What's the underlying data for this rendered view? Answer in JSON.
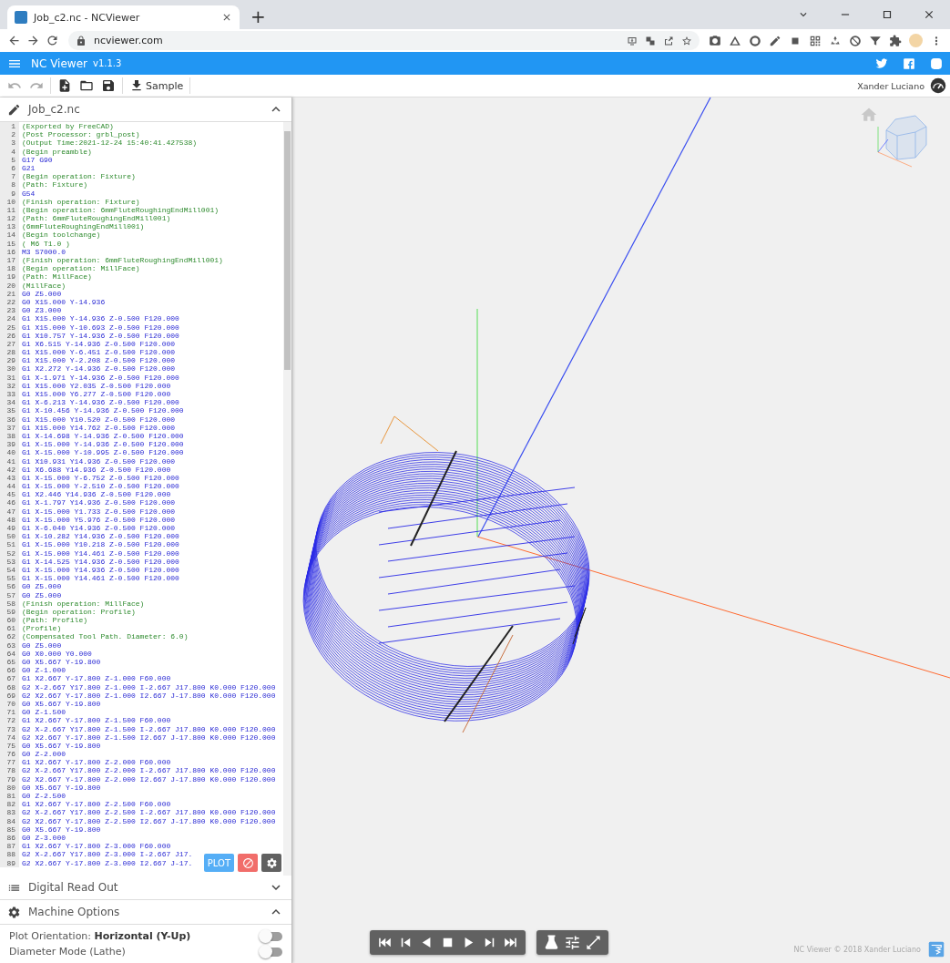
{
  "browser": {
    "tab_title": "Job_c2.nc - NCViewer",
    "new_tab": "+",
    "url": "ncviewer.com"
  },
  "app_bar": {
    "title": "NC Viewer",
    "version": "v1.1.3"
  },
  "toolbar": {
    "buttons": [
      {
        "kind": "undo",
        "disabled": true
      },
      {
        "kind": "redo",
        "disabled": true
      },
      {
        "kind": "new_file",
        "disabled": false
      },
      {
        "kind": "open",
        "disabled": false
      },
      {
        "kind": "save",
        "disabled": false
      },
      {
        "kind": "download",
        "label": "Sample",
        "disabled": false
      }
    ],
    "user": "Xander Luciano"
  },
  "editor": {
    "title": "Job_c2.nc",
    "expanded": true,
    "lines": [
      {
        "n": "1",
        "text": "(Exported by FreeCAD)",
        "kind": "comment"
      },
      {
        "n": "2",
        "text": "(Post Processor: grbl_post)",
        "kind": "comment"
      },
      {
        "n": "3",
        "text": "(Output Time:2021-12-24 15:40:41.427538)",
        "kind": "comment"
      },
      {
        "n": "4",
        "text": "(Begin preamble)",
        "kind": "comment"
      },
      {
        "n": "5",
        "text": "G17 G90",
        "kind": "code"
      },
      {
        "n": "6",
        "text": "G21",
        "kind": "code"
      },
      {
        "n": "7",
        "text": "(Begin operation: Fixture)",
        "kind": "comment"
      },
      {
        "n": "8",
        "text": "(Path: Fixture)",
        "kind": "comment"
      },
      {
        "n": "9",
        "text": "G54",
        "kind": "code"
      },
      {
        "n": "10",
        "text": "(Finish operation: Fixture)",
        "kind": "comment"
      },
      {
        "n": "11",
        "text": "(Begin operation: 6mmFluteRoughingEndMill001)",
        "kind": "comment"
      },
      {
        "n": "12",
        "text": "(Path: 6mmFluteRoughingEndMill001)",
        "kind": "comment"
      },
      {
        "n": "13",
        "text": "(6mmFluteRoughingEndMill001)",
        "kind": "comment"
      },
      {
        "n": "14",
        "text": "(Begin toolchange)",
        "kind": "comment"
      },
      {
        "n": "15",
        "text": "( M6 T1.0 )",
        "kind": "comment"
      },
      {
        "n": "16",
        "text": "M3 S7000.0",
        "kind": "code"
      },
      {
        "n": "17",
        "text": "(Finish operation: 6mmFluteRoughingEndMill001)",
        "kind": "comment"
      },
      {
        "n": "18",
        "text": "(Begin operation: MillFace)",
        "kind": "comment"
      },
      {
        "n": "19",
        "text": "(Path: MillFace)",
        "kind": "comment"
      },
      {
        "n": "20",
        "text": "(MillFace)",
        "kind": "comment"
      },
      {
        "n": "21",
        "text": "G0 Z5.000",
        "kind": "code"
      },
      {
        "n": "22",
        "text": "G0 X15.000 Y-14.936",
        "kind": "code"
      },
      {
        "n": "23",
        "text": "G0 Z3.000",
        "kind": "code"
      },
      {
        "n": "24",
        "text": "G1 X15.000 Y-14.936 Z-0.500 F120.000",
        "kind": "code"
      },
      {
        "n": "25",
        "text": "G1 X15.000 Y-10.693 Z-0.500 F120.000",
        "kind": "code"
      },
      {
        "n": "26",
        "text": "G1 X10.757 Y-14.936 Z-0.500 F120.000",
        "kind": "code"
      },
      {
        "n": "27",
        "text": "G1 X6.515 Y-14.936 Z-0.500 F120.000",
        "kind": "code"
      },
      {
        "n": "28",
        "text": "G1 X15.000 Y-6.451 Z-0.500 F120.000",
        "kind": "code"
      },
      {
        "n": "29",
        "text": "G1 X15.000 Y-2.208 Z-0.500 F120.000",
        "kind": "code"
      },
      {
        "n": "30",
        "text": "G1 X2.272 Y-14.936 Z-0.500 F120.000",
        "kind": "code"
      },
      {
        "n": "31",
        "text": "G1 X-1.971 Y-14.936 Z-0.500 F120.000",
        "kind": "code"
      },
      {
        "n": "32",
        "text": "G1 X15.000 Y2.035 Z-0.500 F120.000",
        "kind": "code"
      },
      {
        "n": "33",
        "text": "G1 X15.000 Y6.277 Z-0.500 F120.000",
        "kind": "code"
      },
      {
        "n": "34",
        "text": "G1 X-6.213 Y-14.936 Z-0.500 F120.000",
        "kind": "code"
      },
      {
        "n": "35",
        "text": "G1 X-10.456 Y-14.936 Z-0.500 F120.000",
        "kind": "code"
      },
      {
        "n": "36",
        "text": "G1 X15.000 Y10.520 Z-0.500 F120.000",
        "kind": "code"
      },
      {
        "n": "37",
        "text": "G1 X15.000 Y14.762 Z-0.500 F120.000",
        "kind": "code"
      },
      {
        "n": "38",
        "text": "G1 X-14.698 Y-14.936 Z-0.500 F120.000",
        "kind": "code"
      },
      {
        "n": "39",
        "text": "G1 X-15.000 Y-14.936 Z-0.500 F120.000",
        "kind": "code"
      },
      {
        "n": "40",
        "text": "G1 X-15.000 Y-10.995 Z-0.500 F120.000",
        "kind": "code"
      },
      {
        "n": "41",
        "text": "G1 X10.931 Y14.936 Z-0.500 F120.000",
        "kind": "code"
      },
      {
        "n": "42",
        "text": "G1 X6.688 Y14.936 Z-0.500 F120.000",
        "kind": "code"
      },
      {
        "n": "43",
        "text": "G1 X-15.000 Y-6.752 Z-0.500 F120.000",
        "kind": "code"
      },
      {
        "n": "44",
        "text": "G1 X-15.000 Y-2.510 Z-0.500 F120.000",
        "kind": "code"
      },
      {
        "n": "45",
        "text": "G1 X2.446 Y14.936 Z-0.500 F120.000",
        "kind": "code"
      },
      {
        "n": "46",
        "text": "G1 X-1.797 Y14.936 Z-0.500 F120.000",
        "kind": "code"
      },
      {
        "n": "47",
        "text": "G1 X-15.000 Y1.733 Z-0.500 F120.000",
        "kind": "code"
      },
      {
        "n": "48",
        "text": "G1 X-15.000 Y5.976 Z-0.500 F120.000",
        "kind": "code"
      },
      {
        "n": "49",
        "text": "G1 X-6.040 Y14.936 Z-0.500 F120.000",
        "kind": "code"
      },
      {
        "n": "50",
        "text": "G1 X-10.282 Y14.936 Z-0.500 F120.000",
        "kind": "code"
      },
      {
        "n": "51",
        "text": "G1 X-15.000 Y10.218 Z-0.500 F120.000",
        "kind": "code"
      },
      {
        "n": "52",
        "text": "G1 X-15.000 Y14.461 Z-0.500 F120.000",
        "kind": "code"
      },
      {
        "n": "53",
        "text": "G1 X-14.525 Y14.936 Z-0.500 F120.000",
        "kind": "code"
      },
      {
        "n": "54",
        "text": "G1 X-15.000 Y14.936 Z-0.500 F120.000",
        "kind": "code"
      },
      {
        "n": "55",
        "text": "G1 X-15.000 Y14.461 Z-0.500 F120.000",
        "kind": "code"
      },
      {
        "n": "56",
        "text": "G0 Z5.000",
        "kind": "code"
      },
      {
        "n": "57",
        "text": "G0 Z5.000",
        "kind": "code"
      },
      {
        "n": "58",
        "text": "(Finish operation: MillFace)",
        "kind": "comment"
      },
      {
        "n": "59",
        "text": "(Begin operation: Profile)",
        "kind": "comment"
      },
      {
        "n": "60",
        "text": "(Path: Profile)",
        "kind": "comment"
      },
      {
        "n": "61",
        "text": "(Profile)",
        "kind": "comment"
      },
      {
        "n": "62",
        "text": "(Compensated Tool Path. Diameter: 6.0)",
        "kind": "comment"
      },
      {
        "n": "63",
        "text": "G0 Z5.000",
        "kind": "code"
      },
      {
        "n": "64",
        "text": "G0 X0.000 Y0.000",
        "kind": "code"
      },
      {
        "n": "65",
        "text": "G0 X5.667 Y-19.800",
        "kind": "code"
      },
      {
        "n": "66",
        "text": "G0 Z-1.000",
        "kind": "code"
      },
      {
        "n": "67",
        "text": "G1 X2.667 Y-17.800 Z-1.000 F60.000",
        "kind": "code"
      },
      {
        "n": "68",
        "text": "G2 X-2.667 Y17.800 Z-1.000 I-2.667 J17.800 K0.000 F120.000",
        "kind": "code"
      },
      {
        "n": "69",
        "text": "G2 X2.667 Y-17.800 Z-1.000 I2.667 J-17.800 K0.000 F120.000",
        "kind": "code"
      },
      {
        "n": "70",
        "text": "G0 X5.667 Y-19.800",
        "kind": "code"
      },
      {
        "n": "71",
        "text": "G0 Z-1.500",
        "kind": "code"
      },
      {
        "n": "72",
        "text": "G1 X2.667 Y-17.800 Z-1.500 F60.000",
        "kind": "code"
      },
      {
        "n": "73",
        "text": "G2 X-2.667 Y17.800 Z-1.500 I-2.667 J17.800 K0.000 F120.000",
        "kind": "code"
      },
      {
        "n": "74",
        "text": "G2 X2.667 Y-17.800 Z-1.500 I2.667 J-17.800 K0.000 F120.000",
        "kind": "code"
      },
      {
        "n": "75",
        "text": "G0 X5.667 Y-19.800",
        "kind": "code"
      },
      {
        "n": "76",
        "text": "G0 Z-2.000",
        "kind": "code"
      },
      {
        "n": "77",
        "text": "G1 X2.667 Y-17.800 Z-2.000 F60.000",
        "kind": "code"
      },
      {
        "n": "78",
        "text": "G2 X-2.667 Y17.800 Z-2.000 I-2.667 J17.800 K0.000 F120.000",
        "kind": "code"
      },
      {
        "n": "79",
        "text": "G2 X2.667 Y-17.800 Z-2.000 I2.667 J-17.800 K0.000 F120.000",
        "kind": "code"
      },
      {
        "n": "80",
        "text": "G0 X5.667 Y-19.800",
        "kind": "code"
      },
      {
        "n": "81",
        "text": "G0 Z-2.500",
        "kind": "code"
      },
      {
        "n": "82",
        "text": "G1 X2.667 Y-17.800 Z-2.500 F60.000",
        "kind": "code"
      },
      {
        "n": "83",
        "text": "G2 X-2.667 Y17.800 Z-2.500 I-2.667 J17.800 K0.000 F120.000",
        "kind": "code"
      },
      {
        "n": "84",
        "text": "G2 X2.667 Y-17.800 Z-2.500 I2.667 J-17.800 K0.000 F120.000",
        "kind": "code"
      },
      {
        "n": "85",
        "text": "G0 X5.667 Y-19.800",
        "kind": "code"
      },
      {
        "n": "86",
        "text": "G0 Z-3.000",
        "kind": "code"
      },
      {
        "n": "87",
        "text": "G1 X2.667 Y-17.800 Z-3.000 F60.000",
        "kind": "code"
      },
      {
        "n": "88",
        "text": "G2 X-2.667 Y17.800 Z-3.000 I-2.667 J17.",
        "kind": "code"
      },
      {
        "n": "89",
        "text": "G2 X2.667 Y-17.800 Z-3.000 I2.667 J-17.",
        "kind": "code"
      }
    ],
    "actions": [
      {
        "kind": "plot",
        "label": "PLOT"
      },
      {
        "kind": "clear"
      },
      {
        "kind": "settings"
      }
    ]
  },
  "panels": [
    {
      "title": "Digital Read Out",
      "kind": "list",
      "expanded": false
    },
    {
      "title": "Machine Options",
      "kind": "gear",
      "expanded": true
    }
  ],
  "machine_options": [
    {
      "label": "Plot Orientation: **Horizontal (Y-Up)**",
      "on": false
    },
    {
      "label": "Diameter Mode (Lathe)",
      "on": false
    }
  ],
  "footer": "NC Viewer © 2018 Xander Luciano"
}
